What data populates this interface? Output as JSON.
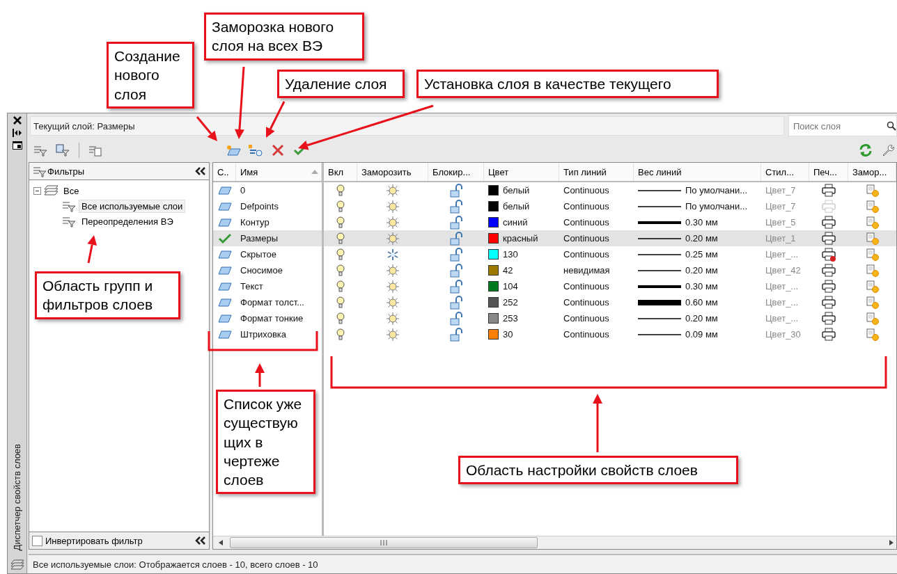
{
  "callouts": [
    {
      "text": "Создание нового слоя"
    },
    {
      "text": "Заморозка нового слоя на всех ВЭ"
    },
    {
      "text": "Удаление слоя"
    },
    {
      "text": "Установка слоя в качестве текущего"
    },
    {
      "text": "Область групп и фильтров слоев"
    },
    {
      "text": "Список уже существую щих в чертеже слоев"
    },
    {
      "text": "Область настройки свойств слоев"
    }
  ],
  "palette": {
    "title": "Диспетчер свойств слоев"
  },
  "current_layer": "Текущий слой: Размеры",
  "search": {
    "placeholder": "Поиск слоя"
  },
  "filters": {
    "title": "Фильтры",
    "tree": [
      {
        "label": "Все",
        "expanded": true,
        "selected": false,
        "children": [
          {
            "label": "Все используемые слои",
            "selected": true
          },
          {
            "label": "Переопределения ВЭ",
            "selected": false
          }
        ]
      }
    ],
    "invert": {
      "label": "Инвертировать фильтр",
      "checked": false
    }
  },
  "columns": [
    "С..",
    "Имя",
    "Вкл",
    "Заморозить",
    "Блокир...",
    "Цвет",
    "Тип линий",
    "Вес линий",
    "Стил...",
    "Печ...",
    "Замор..."
  ],
  "layers": [
    {
      "name": "0",
      "current": false,
      "selected": false,
      "on": true,
      "frozen": false,
      "locked": false,
      "color": "#000000",
      "color_name": "белый",
      "linetype": "Continuous",
      "lineweight": {
        "kind": "thin",
        "text": "По умолчани..."
      },
      "plot_style": "Цвет_7",
      "plottable": true,
      "plot_blocked": false
    },
    {
      "name": "Defpoints",
      "current": false,
      "selected": false,
      "on": true,
      "frozen": false,
      "locked": false,
      "color": "#000000",
      "color_name": "белый",
      "linetype": "Continuous",
      "lineweight": {
        "kind": "thin",
        "text": "По умолчани..."
      },
      "plot_style": "Цвет_7",
      "plottable": false,
      "plot_blocked": false
    },
    {
      "name": "Контур",
      "current": false,
      "selected": false,
      "on": true,
      "frozen": false,
      "locked": false,
      "color": "#0000ff",
      "color_name": "синий",
      "linetype": "Continuous",
      "lineweight": {
        "kind": "thick",
        "text": "0.30 мм"
      },
      "plot_style": "Цвет_5",
      "plottable": true,
      "plot_blocked": false
    },
    {
      "name": "Размеры",
      "current": true,
      "selected": true,
      "on": true,
      "frozen": false,
      "locked": false,
      "color": "#ff0000",
      "color_name": "красный",
      "linetype": "Continuous",
      "lineweight": {
        "kind": "thin",
        "text": "0.20 мм"
      },
      "plot_style": "Цвет_1",
      "plottable": true,
      "plot_blocked": false
    },
    {
      "name": "Скрытое",
      "current": false,
      "selected": false,
      "on": true,
      "frozen": true,
      "locked": false,
      "color": "#00ffff",
      "color_name": "130",
      "linetype": "Continuous",
      "lineweight": {
        "kind": "thin",
        "text": "0.25 мм"
      },
      "plot_style": "Цвет_...",
      "plottable": true,
      "plot_blocked": true
    },
    {
      "name": "Сносимое",
      "current": false,
      "selected": false,
      "on": true,
      "frozen": false,
      "locked": false,
      "color": "#9c7a00",
      "color_name": "42",
      "linetype": "невидимая",
      "lineweight": {
        "kind": "thin",
        "text": "0.20 мм"
      },
      "plot_style": "Цвет_42",
      "plottable": true,
      "plot_blocked": false
    },
    {
      "name": "Текст",
      "current": false,
      "selected": false,
      "on": true,
      "frozen": false,
      "locked": false,
      "color": "#007a1f",
      "color_name": "104",
      "linetype": "Continuous",
      "lineweight": {
        "kind": "thick",
        "text": "0.30 мм"
      },
      "plot_style": "Цвет_...",
      "plottable": true,
      "plot_blocked": false
    },
    {
      "name": "Формат толст...",
      "current": false,
      "selected": false,
      "on": true,
      "frozen": false,
      "locked": false,
      "color": "#555555",
      "color_name": "252",
      "linetype": "Continuous",
      "lineweight": {
        "kind": "heavy",
        "text": "0.60 мм"
      },
      "plot_style": "Цвет_...",
      "plottable": true,
      "plot_blocked": false
    },
    {
      "name": "Формат тонкие",
      "current": false,
      "selected": false,
      "on": true,
      "frozen": false,
      "locked": false,
      "color": "#888888",
      "color_name": "253",
      "linetype": "Continuous",
      "lineweight": {
        "kind": "thin",
        "text": "0.20 мм"
      },
      "plot_style": "Цвет_...",
      "plottable": true,
      "plot_blocked": false
    },
    {
      "name": "Штриховка",
      "current": false,
      "selected": false,
      "on": true,
      "frozen": false,
      "locked": false,
      "color": "#ff8000",
      "color_name": "30",
      "linetype": "Continuous",
      "lineweight": {
        "kind": "thin",
        "text": "0.09 мм"
      },
      "plot_style": "Цвет_30",
      "plottable": true,
      "plot_blocked": false
    }
  ],
  "status_bar": "Все используемые слои: Отображается слоев - 10, всего слоев - 10"
}
